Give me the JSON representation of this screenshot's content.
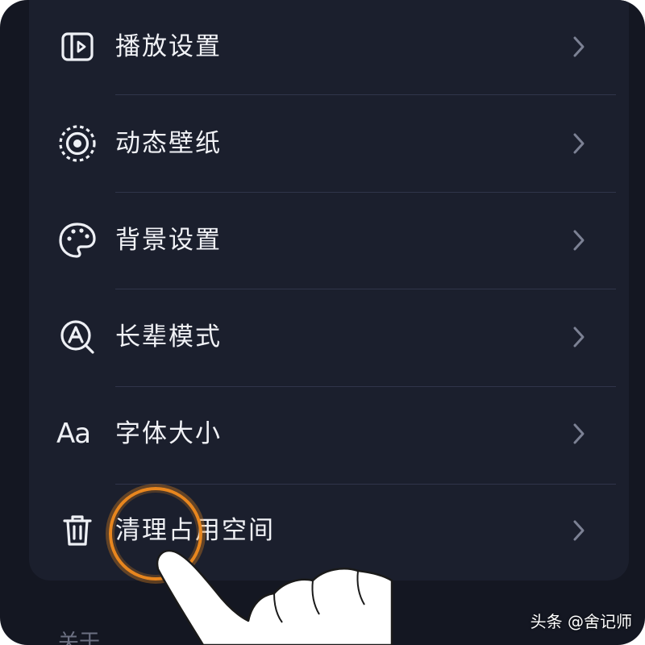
{
  "settings": {
    "items": [
      {
        "label": "播放设置",
        "icon": "playback-icon"
      },
      {
        "label": "动态壁纸",
        "icon": "live-wallpaper-icon"
      },
      {
        "label": "背景设置",
        "icon": "palette-icon"
      },
      {
        "label": "长辈模式",
        "icon": "elder-mode-icon"
      },
      {
        "label": "字体大小",
        "icon": "font-size-icon",
        "icon_text": "Aa"
      },
      {
        "label": "清理占用空间",
        "icon": "trash-icon"
      }
    ]
  },
  "section": {
    "label": "关于"
  },
  "watermark": {
    "text": "头条 @舍记师"
  },
  "colors": {
    "background": "#141722",
    "card": "#1b1f2d",
    "text": "#f1f2f6",
    "highlight": "#e8861e"
  }
}
